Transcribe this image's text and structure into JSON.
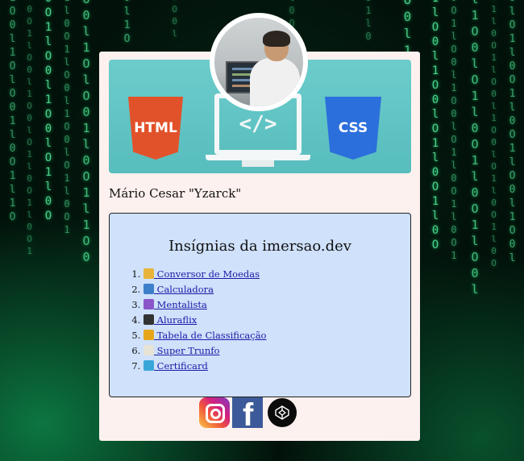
{
  "profile": {
    "name": "Mário Cesar \"Yzarck\""
  },
  "banner": {
    "left_label": "HTML",
    "right_label": "CSS",
    "center_symbol": "</>"
  },
  "badges": {
    "title": "Insígnias da imersao.dev",
    "items": [
      {
        "label": " Conversor de Moedas",
        "icon": "money-bag-icon",
        "glyph": "💰",
        "color": "#e8b33a"
      },
      {
        "label": " Calculadora",
        "icon": "abacus-icon",
        "glyph": "🧮",
        "color": "#3e7fc9"
      },
      {
        "label": " Mentalista",
        "icon": "crystal-ball-icon",
        "glyph": "🔮",
        "color": "#8a55c9"
      },
      {
        "label": " Aluraflix",
        "icon": "clapperboard-icon",
        "glyph": "🎬",
        "color": "#333333"
      },
      {
        "label": " Tabela de Classificação",
        "icon": "trophy-icon",
        "glyph": "🏆",
        "color": "#e6a619"
      },
      {
        "label": " Super Trunfo",
        "icon": "playing-card-icon",
        "glyph": "🃏",
        "color": "#e7e2d6"
      },
      {
        "label": " Certificard",
        "icon": "globe-icon",
        "glyph": "🌐",
        "color": "#3aa6d8"
      }
    ]
  },
  "social": [
    {
      "name": "instagram-icon"
    },
    {
      "name": "facebook-icon",
      "glyph": "f"
    },
    {
      "name": "codepen-icon"
    }
  ]
}
